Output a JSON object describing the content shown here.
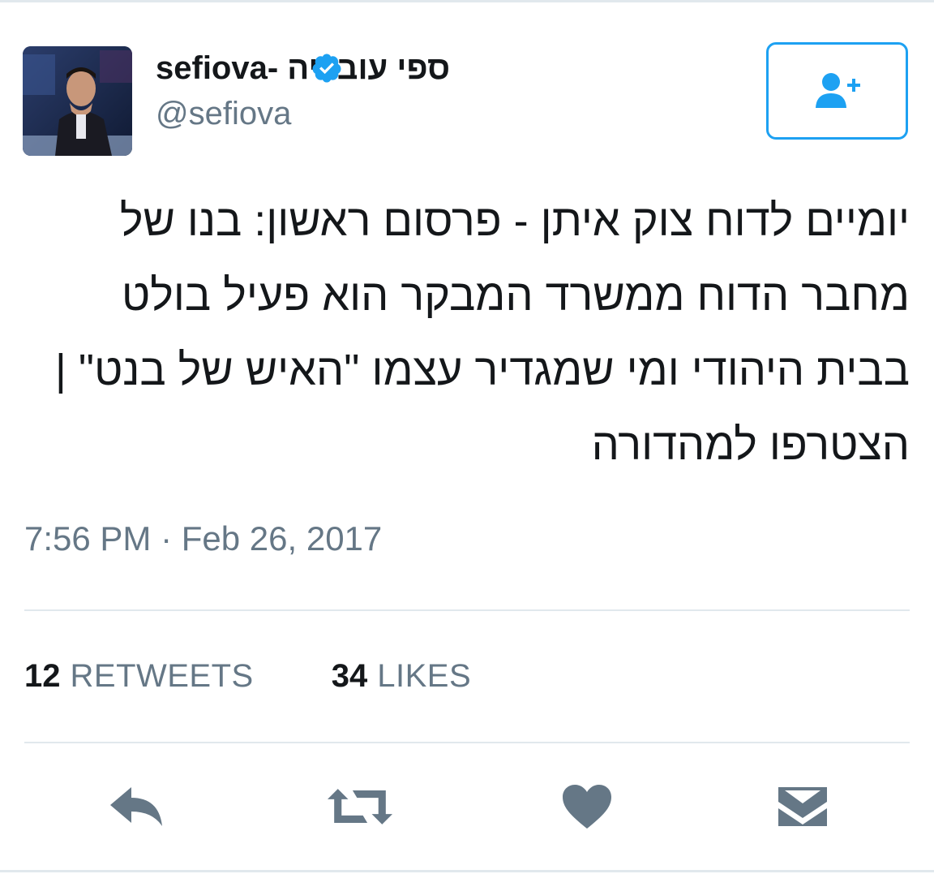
{
  "user": {
    "display_name": "ספי עובדיה -sefiova",
    "handle": "@sefiova",
    "verified_icon": "verified-badge-icon",
    "avatar": "profile-avatar"
  },
  "follow_button": {
    "icon": "add-user-icon"
  },
  "tweet": {
    "text": "יומיים לדוח צוק איתן - פרסום ראשון: בנו של מחבר הדוח ממשרד המבקר הוא פעיל בולט בבית היהודי ומי שמגדיר עצמו \"האיש של בנט\" | הצטרפו למהדורה",
    "timestamp": "7:56 PM · Feb 26, 2017"
  },
  "stats": {
    "retweets_count": "12",
    "retweets_label": "RETWEETS",
    "likes_count": "34",
    "likes_label": "LIKES"
  },
  "actions": {
    "reply_icon": "reply-icon",
    "retweet_icon": "retweet-icon",
    "like_icon": "heart-icon",
    "message_icon": "envelope-icon"
  },
  "colors": {
    "accent": "#1da1f2",
    "secondary_text": "#657786",
    "icon_gray": "#657786",
    "divider": "#e1e8ed"
  }
}
